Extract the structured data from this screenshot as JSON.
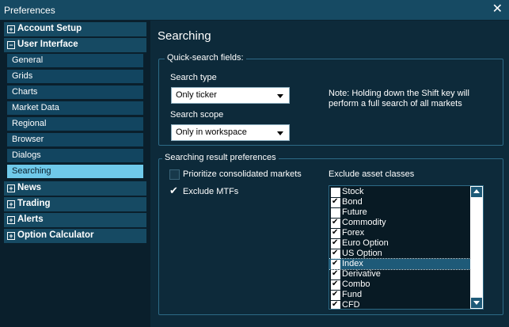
{
  "window": {
    "title": "Preferences"
  },
  "sidebar": {
    "cat_account": "Account Setup",
    "cat_ui": "User Interface",
    "subs": [
      "General",
      "Grids",
      "Charts",
      "Market Data",
      "Regional",
      "Browser",
      "Dialogs",
      "Searching"
    ],
    "cat_news": "News",
    "cat_trading": "Trading",
    "cat_alerts": "Alerts",
    "cat_option": "Option Calculator",
    "expand_minus": "−",
    "expand_plus": "+"
  },
  "content": {
    "heading": "Searching",
    "quick": {
      "title": "Quick-search fields:",
      "type_label": "Search type",
      "type_value": "Only ticker",
      "scope_label": "Search scope",
      "scope_value": "Only in workspace",
      "note_line1": "Note: Holding down the Shift key will",
      "note_line2": "perform a full search of all markets"
    },
    "result": {
      "title": "Searching result preferences",
      "prioritize": "Prioritize consolidated markets",
      "prioritize_checked": false,
      "exclude_mtfs": "Exclude MTFs",
      "exclude_mtfs_checked": true,
      "asset_label": "Exclude asset classes",
      "assets": [
        {
          "label": "Stock",
          "checked": false
        },
        {
          "label": "Bond",
          "checked": true
        },
        {
          "label": "Future",
          "checked": false
        },
        {
          "label": "Commodity",
          "checked": true
        },
        {
          "label": "Forex",
          "checked": true
        },
        {
          "label": "Euro Option",
          "checked": true
        },
        {
          "label": "US Option",
          "checked": true
        },
        {
          "label": "Index",
          "checked": true
        },
        {
          "label": "Derivative",
          "checked": true
        },
        {
          "label": "Combo",
          "checked": true
        },
        {
          "label": "Fund",
          "checked": true
        },
        {
          "label": "CFD",
          "checked": true
        }
      ],
      "highlighted_index": 7
    }
  }
}
